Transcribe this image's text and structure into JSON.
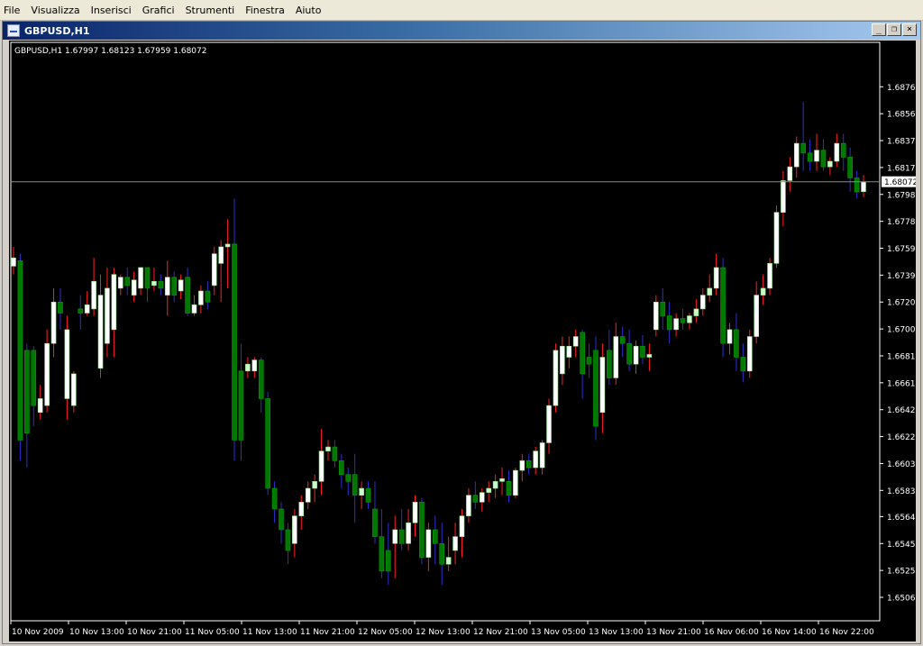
{
  "menu": [
    "File",
    "Visualizza",
    "Inserisci",
    "Grafici",
    "Strumenti",
    "Finestra",
    "Aiuto"
  ],
  "window": {
    "title": "GBPUSD,H1",
    "minimize_glyph": "_",
    "restore_glyph": "❐",
    "close_glyph": "×"
  },
  "chart_data": {
    "type": "candlestick",
    "symbol": "GBPUSD",
    "timeframe": "H1",
    "info_label": "GBPUSD,H1  1.67997 1.68123 1.67959 1.68072",
    "current_price": 1.68072,
    "current_price_label": "1.68072",
    "ylim": [
      1.6506,
      1.6886
    ],
    "y_ticks": [
      "1.68760",
      "1.68565",
      "1.68370",
      "1.68175",
      "1.67980",
      "1.67785",
      "1.67590",
      "1.67395",
      "1.67200",
      "1.67005",
      "1.66810",
      "1.66615",
      "1.66420",
      "1.66225",
      "1.66030",
      "1.65835",
      "1.65645",
      "1.65450",
      "1.65255",
      "1.65060"
    ],
    "x_ticks": [
      "10 Nov 2009",
      "10 Nov 13:00",
      "10 Nov 21:00",
      "11 Nov 05:00",
      "11 Nov 13:00",
      "11 Nov 21:00",
      "12 Nov 05:00",
      "12 Nov 13:00",
      "12 Nov 21:00",
      "13 Nov 05:00",
      "13 Nov 13:00",
      "13 Nov 21:00",
      "16 Nov 06:00",
      "16 Nov 14:00",
      "16 Nov 22:00"
    ],
    "colors": {
      "background": "#000000",
      "bull_body": "#ffffff",
      "bull_wick": "#ff2020",
      "bull_doji_body": "#ccffcc",
      "bear_body": "#007700",
      "bear_wick": "#2f2fcf",
      "axis_text": "#ffffff",
      "bid_line": "#8c8c8c"
    },
    "candles": [
      {
        "o": 1.6746,
        "h": 1.676,
        "l": 1.674,
        "c": 1.6752
      },
      {
        "o": 1.675,
        "h": 1.6755,
        "l": 1.6605,
        "c": 1.662
      },
      {
        "o": 1.6685,
        "h": 1.669,
        "l": 1.66,
        "c": 1.6625
      },
      {
        "o": 1.6685,
        "h": 1.6688,
        "l": 1.663,
        "c": 1.6645
      },
      {
        "o": 1.664,
        "h": 1.666,
        "l": 1.6635,
        "c": 1.665
      },
      {
        "o": 1.6645,
        "h": 1.67,
        "l": 1.664,
        "c": 1.669
      },
      {
        "o": 1.669,
        "h": 1.673,
        "l": 1.668,
        "c": 1.672
      },
      {
        "o": 1.672,
        "h": 1.673,
        "l": 1.67,
        "c": 1.6712
      },
      {
        "o": 1.665,
        "h": 1.671,
        "l": 1.6635,
        "c": 1.67
      },
      {
        "o": 1.6645,
        "h": 1.667,
        "l": 1.664,
        "c": 1.6668
      },
      {
        "o": 1.6715,
        "h": 1.6725,
        "l": 1.67,
        "c": 1.6712
      },
      {
        "o": 1.6712,
        "h": 1.6728,
        "l": 1.671,
        "c": 1.6718
      },
      {
        "o": 1.6715,
        "h": 1.6752,
        "l": 1.671,
        "c": 1.6735
      },
      {
        "o": 1.6672,
        "h": 1.674,
        "l": 1.6665,
        "c": 1.6725
      },
      {
        "o": 1.669,
        "h": 1.6745,
        "l": 1.668,
        "c": 1.673
      },
      {
        "o": 1.67,
        "h": 1.6745,
        "l": 1.668,
        "c": 1.674
      },
      {
        "o": 1.673,
        "h": 1.674,
        "l": 1.6725,
        "c": 1.6738
      },
      {
        "o": 1.6738,
        "h": 1.6745,
        "l": 1.6725,
        "c": 1.6732
      },
      {
        "o": 1.6725,
        "h": 1.6742,
        "l": 1.672,
        "c": 1.6736
      },
      {
        "o": 1.673,
        "h": 1.6745,
        "l": 1.6725,
        "c": 1.6745
      },
      {
        "o": 1.6745,
        "h": 1.6745,
        "l": 1.672,
        "c": 1.673
      },
      {
        "o": 1.6732,
        "h": 1.6745,
        "l": 1.6728,
        "c": 1.6735
      },
      {
        "o": 1.6735,
        "h": 1.674,
        "l": 1.6725,
        "c": 1.673
      },
      {
        "o": 1.6725,
        "h": 1.675,
        "l": 1.671,
        "c": 1.6738
      },
      {
        "o": 1.6738,
        "h": 1.6742,
        "l": 1.672,
        "c": 1.6725
      },
      {
        "o": 1.6728,
        "h": 1.674,
        "l": 1.6722,
        "c": 1.6736
      },
      {
        "o": 1.6738,
        "h": 1.6745,
        "l": 1.671,
        "c": 1.6712
      },
      {
        "o": 1.6712,
        "h": 1.6725,
        "l": 1.671,
        "c": 1.6718
      },
      {
        "o": 1.6718,
        "h": 1.6732,
        "l": 1.6712,
        "c": 1.6728
      },
      {
        "o": 1.6728,
        "h": 1.6735,
        "l": 1.6715,
        "c": 1.672
      },
      {
        "o": 1.6732,
        "h": 1.676,
        "l": 1.6725,
        "c": 1.6755
      },
      {
        "o": 1.6748,
        "h": 1.6765,
        "l": 1.672,
        "c": 1.676
      },
      {
        "o": 1.676,
        "h": 1.678,
        "l": 1.673,
        "c": 1.6762
      },
      {
        "o": 1.6762,
        "h": 1.6795,
        "l": 1.6605,
        "c": 1.662
      },
      {
        "o": 1.667,
        "h": 1.669,
        "l": 1.6605,
        "c": 1.662
      },
      {
        "o": 1.667,
        "h": 1.668,
        "l": 1.6665,
        "c": 1.6675
      },
      {
        "o": 1.667,
        "h": 1.668,
        "l": 1.6665,
        "c": 1.6678
      },
      {
        "o": 1.6678,
        "h": 1.668,
        "l": 1.664,
        "c": 1.665
      },
      {
        "o": 1.665,
        "h": 1.6655,
        "l": 1.658,
        "c": 1.6585
      },
      {
        "o": 1.6585,
        "h": 1.659,
        "l": 1.656,
        "c": 1.657
      },
      {
        "o": 1.657,
        "h": 1.6575,
        "l": 1.6545,
        "c": 1.6555
      },
      {
        "o": 1.6555,
        "h": 1.656,
        "l": 1.653,
        "c": 1.654
      },
      {
        "o": 1.6545,
        "h": 1.657,
        "l": 1.6535,
        "c": 1.6565
      },
      {
        "o": 1.6565,
        "h": 1.658,
        "l": 1.6555,
        "c": 1.6575
      },
      {
        "o": 1.6575,
        "h": 1.659,
        "l": 1.657,
        "c": 1.6585
      },
      {
        "o": 1.6585,
        "h": 1.6595,
        "l": 1.6575,
        "c": 1.659
      },
      {
        "o": 1.659,
        "h": 1.6628,
        "l": 1.658,
        "c": 1.6612
      },
      {
        "o": 1.6612,
        "h": 1.662,
        "l": 1.6605,
        "c": 1.6615
      },
      {
        "o": 1.6615,
        "h": 1.662,
        "l": 1.66,
        "c": 1.6605
      },
      {
        "o": 1.6605,
        "h": 1.661,
        "l": 1.6585,
        "c": 1.6595
      },
      {
        "o": 1.6595,
        "h": 1.66,
        "l": 1.658,
        "c": 1.659
      },
      {
        "o": 1.6595,
        "h": 1.661,
        "l": 1.656,
        "c": 1.658
      },
      {
        "o": 1.658,
        "h": 1.659,
        "l": 1.657,
        "c": 1.6585
      },
      {
        "o": 1.6585,
        "h": 1.659,
        "l": 1.657,
        "c": 1.6575
      },
      {
        "o": 1.657,
        "h": 1.659,
        "l": 1.6545,
        "c": 1.655
      },
      {
        "o": 1.655,
        "h": 1.657,
        "l": 1.652,
        "c": 1.6525
      },
      {
        "o": 1.654,
        "h": 1.656,
        "l": 1.6515,
        "c": 1.6525
      },
      {
        "o": 1.6545,
        "h": 1.6565,
        "l": 1.652,
        "c": 1.6555
      },
      {
        "o": 1.6555,
        "h": 1.657,
        "l": 1.654,
        "c": 1.6545
      },
      {
        "o": 1.6545,
        "h": 1.657,
        "l": 1.654,
        "c": 1.656
      },
      {
        "o": 1.656,
        "h": 1.658,
        "l": 1.655,
        "c": 1.6575
      },
      {
        "o": 1.6575,
        "h": 1.6578,
        "l": 1.653,
        "c": 1.6535
      },
      {
        "o": 1.6535,
        "h": 1.656,
        "l": 1.6525,
        "c": 1.6555
      },
      {
        "o": 1.6555,
        "h": 1.6565,
        "l": 1.653,
        "c": 1.6545
      },
      {
        "o": 1.6545,
        "h": 1.656,
        "l": 1.6515,
        "c": 1.653
      },
      {
        "o": 1.653,
        "h": 1.655,
        "l": 1.6525,
        "c": 1.6535
      },
      {
        "o": 1.654,
        "h": 1.656,
        "l": 1.653,
        "c": 1.655
      },
      {
        "o": 1.655,
        "h": 1.657,
        "l": 1.6535,
        "c": 1.6565
      },
      {
        "o": 1.6565,
        "h": 1.6585,
        "l": 1.656,
        "c": 1.658
      },
      {
        "o": 1.658,
        "h": 1.659,
        "l": 1.657,
        "c": 1.6575
      },
      {
        "o": 1.6575,
        "h": 1.6585,
        "l": 1.6568,
        "c": 1.6582
      },
      {
        "o": 1.6582,
        "h": 1.659,
        "l": 1.6575,
        "c": 1.6585
      },
      {
        "o": 1.6585,
        "h": 1.6595,
        "l": 1.6578,
        "c": 1.659
      },
      {
        "o": 1.659,
        "h": 1.66,
        "l": 1.658,
        "c": 1.6592
      },
      {
        "o": 1.659,
        "h": 1.6598,
        "l": 1.6575,
        "c": 1.658
      },
      {
        "o": 1.658,
        "h": 1.66,
        "l": 1.6578,
        "c": 1.6598
      },
      {
        "o": 1.6598,
        "h": 1.661,
        "l": 1.659,
        "c": 1.6605
      },
      {
        "o": 1.6605,
        "h": 1.661,
        "l": 1.6595,
        "c": 1.66
      },
      {
        "o": 1.66,
        "h": 1.6615,
        "l": 1.6595,
        "c": 1.6612
      },
      {
        "o": 1.66,
        "h": 1.662,
        "l": 1.6595,
        "c": 1.6618
      },
      {
        "o": 1.6618,
        "h": 1.665,
        "l": 1.661,
        "c": 1.6645
      },
      {
        "o": 1.6645,
        "h": 1.669,
        "l": 1.664,
        "c": 1.6685
      },
      {
        "o": 1.6668,
        "h": 1.6695,
        "l": 1.666,
        "c": 1.6688
      },
      {
        "o": 1.668,
        "h": 1.6695,
        "l": 1.6672,
        "c": 1.6688
      },
      {
        "o": 1.6688,
        "h": 1.67,
        "l": 1.668,
        "c": 1.6695
      },
      {
        "o": 1.6698,
        "h": 1.67,
        "l": 1.665,
        "c": 1.6668
      },
      {
        "o": 1.668,
        "h": 1.669,
        "l": 1.6665,
        "c": 1.6675
      },
      {
        "o": 1.6685,
        "h": 1.6695,
        "l": 1.662,
        "c": 1.663
      },
      {
        "o": 1.664,
        "h": 1.669,
        "l": 1.6625,
        "c": 1.668
      },
      {
        "o": 1.6685,
        "h": 1.67,
        "l": 1.666,
        "c": 1.6665
      },
      {
        "o": 1.6665,
        "h": 1.6705,
        "l": 1.666,
        "c": 1.6695
      },
      {
        "o": 1.6695,
        "h": 1.6702,
        "l": 1.668,
        "c": 1.669
      },
      {
        "o": 1.669,
        "h": 1.67,
        "l": 1.667,
        "c": 1.6675
      },
      {
        "o": 1.6675,
        "h": 1.6692,
        "l": 1.6668,
        "c": 1.6688
      },
      {
        "o": 1.6688,
        "h": 1.6696,
        "l": 1.6675,
        "c": 1.668
      },
      {
        "o": 1.668,
        "h": 1.669,
        "l": 1.667,
        "c": 1.6682
      },
      {
        "o": 1.67,
        "h": 1.6725,
        "l": 1.6695,
        "c": 1.672
      },
      {
        "o": 1.672,
        "h": 1.673,
        "l": 1.67,
        "c": 1.671
      },
      {
        "o": 1.671,
        "h": 1.672,
        "l": 1.669,
        "c": 1.67
      },
      {
        "o": 1.67,
        "h": 1.6712,
        "l": 1.6695,
        "c": 1.6708
      },
      {
        "o": 1.6708,
        "h": 1.6715,
        "l": 1.67,
        "c": 1.6705
      },
      {
        "o": 1.6705,
        "h": 1.6712,
        "l": 1.67,
        "c": 1.671
      },
      {
        "o": 1.671,
        "h": 1.6722,
        "l": 1.6705,
        "c": 1.6715
      },
      {
        "o": 1.6715,
        "h": 1.673,
        "l": 1.671,
        "c": 1.6725
      },
      {
        "o": 1.6725,
        "h": 1.674,
        "l": 1.672,
        "c": 1.673
      },
      {
        "o": 1.673,
        "h": 1.6755,
        "l": 1.6725,
        "c": 1.6745
      },
      {
        "o": 1.6745,
        "h": 1.6752,
        "l": 1.668,
        "c": 1.669
      },
      {
        "o": 1.669,
        "h": 1.6705,
        "l": 1.6682,
        "c": 1.67
      },
      {
        "o": 1.67,
        "h": 1.6712,
        "l": 1.667,
        "c": 1.668
      },
      {
        "o": 1.668,
        "h": 1.669,
        "l": 1.6662,
        "c": 1.667
      },
      {
        "o": 1.667,
        "h": 1.67,
        "l": 1.6665,
        "c": 1.6695
      },
      {
        "o": 1.6695,
        "h": 1.6735,
        "l": 1.669,
        "c": 1.6725
      },
      {
        "o": 1.6725,
        "h": 1.674,
        "l": 1.6718,
        "c": 1.673
      },
      {
        "o": 1.673,
        "h": 1.6752,
        "l": 1.6725,
        "c": 1.6748
      },
      {
        "o": 1.6748,
        "h": 1.679,
        "l": 1.6745,
        "c": 1.6785
      },
      {
        "o": 1.6785,
        "h": 1.6815,
        "l": 1.6775,
        "c": 1.6808
      },
      {
        "o": 1.6808,
        "h": 1.6825,
        "l": 1.68,
        "c": 1.6818
      },
      {
        "o": 1.6818,
        "h": 1.684,
        "l": 1.681,
        "c": 1.6835
      },
      {
        "o": 1.6835,
        "h": 1.6865,
        "l": 1.6815,
        "c": 1.6828
      },
      {
        "o": 1.6828,
        "h": 1.6838,
        "l": 1.6815,
        "c": 1.6822
      },
      {
        "o": 1.6822,
        "h": 1.6842,
        "l": 1.6815,
        "c": 1.683
      },
      {
        "o": 1.683,
        "h": 1.6838,
        "l": 1.6815,
        "c": 1.6818
      },
      {
        "o": 1.6818,
        "h": 1.6825,
        "l": 1.6812,
        "c": 1.6822
      },
      {
        "o": 1.6822,
        "h": 1.6842,
        "l": 1.6818,
        "c": 1.6835
      },
      {
        "o": 1.6835,
        "h": 1.6842,
        "l": 1.6815,
        "c": 1.6825
      },
      {
        "o": 1.6825,
        "h": 1.6832,
        "l": 1.68,
        "c": 1.681
      },
      {
        "o": 1.681,
        "h": 1.6815,
        "l": 1.6795,
        "c": 1.68
      },
      {
        "o": 1.68,
        "h": 1.6812,
        "l": 1.6796,
        "c": 1.6807
      }
    ]
  }
}
